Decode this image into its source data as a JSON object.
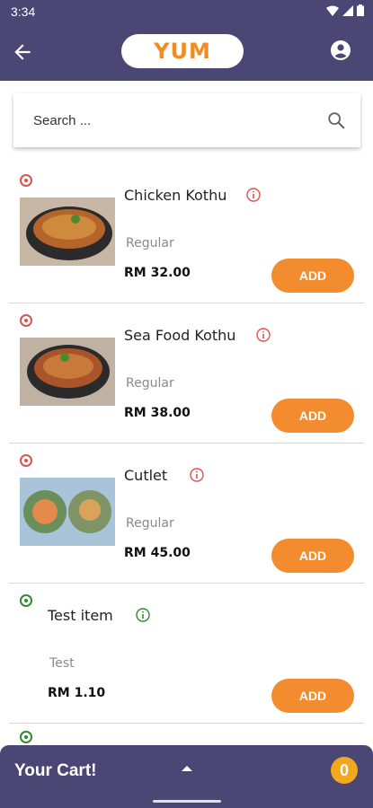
{
  "status": {
    "time": "3:34"
  },
  "header": {
    "logo_text": "YUM"
  },
  "search": {
    "placeholder": "Search ..."
  },
  "items": [
    {
      "name": "Chicken Kothu",
      "variant": "Regular",
      "price": "RM 32.00",
      "add_label": "ADD",
      "has_image": true,
      "indicator_color": "#d9534f"
    },
    {
      "name": "Sea Food Kothu",
      "variant": "Regular",
      "price": "RM 38.00",
      "add_label": "ADD",
      "has_image": true,
      "indicator_color": "#d9534f"
    },
    {
      "name": "Cutlet",
      "variant": "Regular",
      "price": "RM 45.00",
      "add_label": "ADD",
      "has_image": true,
      "indicator_color": "#d9534f"
    },
    {
      "name": "Test item",
      "variant": "Test",
      "price": "RM 1.10",
      "add_label": "ADD",
      "has_image": false,
      "indicator_color": "#2e8b2e"
    }
  ],
  "cart": {
    "label": "Your Cart!",
    "count": "0"
  },
  "colors": {
    "primary": "#4a4775",
    "accent": "#f28c2e",
    "badge": "#f2a81e"
  }
}
